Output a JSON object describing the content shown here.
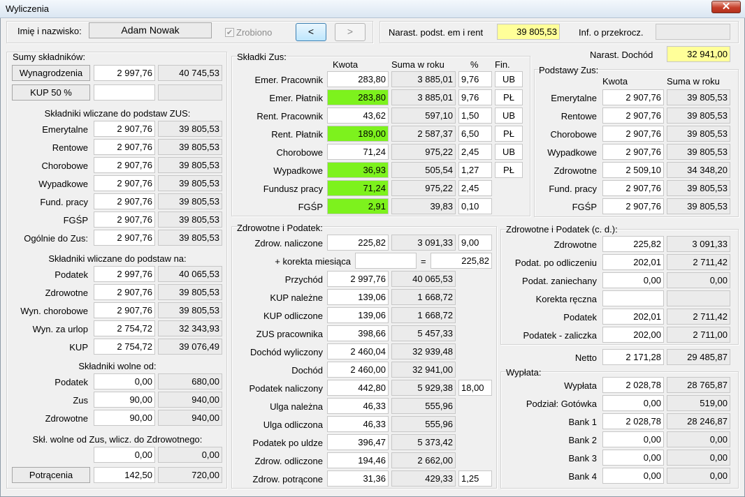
{
  "window": {
    "title": "Wyliczenia",
    "close_glyph": "✕"
  },
  "top": {
    "name_label": "Imię i nazwisko:",
    "name_value": "Adam Nowak",
    "done_label": "Zrobiono",
    "done_checked": true,
    "prev_label": "<",
    "next_label": ">",
    "narast_label": "Narast. podst. em i rent",
    "narast_value": "39 805,53",
    "info_label": "Inf. o przekrocz.",
    "info_value": ""
  },
  "left": {
    "title": "Sumy składników:",
    "wyn": {
      "label": "Wynagrodzenia",
      "kwota": "2 997,76",
      "rok": "40 745,53"
    },
    "kup50": {
      "label": "KUP 50 %",
      "kwota": "",
      "rok": ""
    },
    "zus_header": "Składniki wliczane do podstaw ZUS:",
    "zus_rows": [
      {
        "label": "Emerytalne",
        "kwota": "2 907,76",
        "rok": "39 805,53"
      },
      {
        "label": "Rentowe",
        "kwota": "2 907,76",
        "rok": "39 805,53"
      },
      {
        "label": "Chorobowe",
        "kwota": "2 907,76",
        "rok": "39 805,53"
      },
      {
        "label": "Wypadkowe",
        "kwota": "2 907,76",
        "rok": "39 805,53"
      },
      {
        "label": "Fund. pracy",
        "kwota": "2 907,76",
        "rok": "39 805,53"
      },
      {
        "label": "FGŚP",
        "kwota": "2 907,76",
        "rok": "39 805,53"
      },
      {
        "label": "Ogólnie do Zus:",
        "kwota": "2 907,76",
        "rok": "39 805,53"
      }
    ],
    "na_header": "Składniki wliczane do podstaw na:",
    "na_rows": [
      {
        "label": "Podatek",
        "kwota": "2 997,76",
        "rok": "40 065,53"
      },
      {
        "label": "Zdrowotne",
        "kwota": "2 907,76",
        "rok": "39 805,53"
      },
      {
        "label": "Wyn. chorobowe",
        "kwota": "2 907,76",
        "rok": "39 805,53"
      },
      {
        "label": "Wyn. za urlop",
        "kwota": "2 754,72",
        "rok": "32 343,93"
      },
      {
        "label": "KUP",
        "kwota": "2 754,72",
        "rok": "39 076,49"
      }
    ],
    "wolne_header": "Składniki wolne od:",
    "wolne_rows": [
      {
        "label": "Podatek",
        "kwota": "0,00",
        "rok": "680,00"
      },
      {
        "label": "Zus",
        "kwota": "90,00",
        "rok": "940,00"
      },
      {
        "label": "Zdrowotne",
        "kwota": "90,00",
        "rok": "940,00"
      }
    ],
    "skl_header": "Skł. wolne od Zus, wlicz. do Zdrowotnego:",
    "skl_row": {
      "kwota": "0,00",
      "rok": "0,00"
    },
    "potr": {
      "label": "Potrącenia",
      "kwota": "142,50",
      "rok": "720,00"
    }
  },
  "zus": {
    "title": "Składki Zus:",
    "headers": {
      "kwota": "Kwota",
      "rok": "Suma w roku",
      "pct": "%",
      "fin": "Fin."
    },
    "rows": [
      {
        "label": "Emer. Pracownik",
        "kwota": "283,80",
        "rok": "3 885,01",
        "pct": "9,76",
        "fin": "UB",
        "hl": false
      },
      {
        "label": "Emer. Płatnik",
        "kwota": "283,80",
        "rok": "3 885,01",
        "pct": "9,76",
        "fin": "PŁ",
        "hl": true
      },
      {
        "label": "Rent. Pracownik",
        "kwota": "43,62",
        "rok": "597,10",
        "pct": "1,50",
        "fin": "UB",
        "hl": false
      },
      {
        "label": "Rent. Płatnik",
        "kwota": "189,00",
        "rok": "2 587,37",
        "pct": "6,50",
        "fin": "PŁ",
        "hl": true
      },
      {
        "label": "Chorobowe",
        "kwota": "71,24",
        "rok": "975,22",
        "pct": "2,45",
        "fin": "UB",
        "hl": false
      },
      {
        "label": "Wypadkowe",
        "kwota": "36,93",
        "rok": "505,54",
        "pct": "1,27",
        "fin": "PŁ",
        "hl": true
      },
      {
        "label": "Fundusz pracy",
        "kwota": "71,24",
        "rok": "975,22",
        "pct": "2,45",
        "fin": null,
        "hl": true
      },
      {
        "label": "FGŚP",
        "kwota": "2,91",
        "rok": "39,83",
        "pct": "0,10",
        "fin": null,
        "hl": true
      }
    ]
  },
  "right_top": {
    "dochod_label": "Narast. Dochód",
    "dochod_value": "32 941,00",
    "title": "Podstawy Zus:",
    "headers": {
      "kwota": "Kwota",
      "rok": "Suma w roku"
    },
    "rows": [
      {
        "label": "Emerytalne",
        "kwota": "2 907,76",
        "rok": "39 805,53"
      },
      {
        "label": "Rentowe",
        "kwota": "2 907,76",
        "rok": "39 805,53"
      },
      {
        "label": "Chorobowe",
        "kwota": "2 907,76",
        "rok": "39 805,53"
      },
      {
        "label": "Wypadkowe",
        "kwota": "2 907,76",
        "rok": "39 805,53"
      },
      {
        "label": "Zdrowotne",
        "kwota": "2 509,10",
        "rok": "34 348,20"
      },
      {
        "label": "Fund. pracy",
        "kwota": "2 907,76",
        "rok": "39 805,53"
      },
      {
        "label": "FGŚP",
        "kwota": "2 907,76",
        "rok": "39 805,53"
      }
    ]
  },
  "zdrow": {
    "title": "Zdrowotne i Podatek:",
    "naliczone": {
      "label": "Zdrow. naliczone",
      "kwota": "225,82",
      "rok": "3 091,33",
      "pct": "9,00"
    },
    "korekta": {
      "label": "+ korekta miesiąca",
      "value": "",
      "eq": "=",
      "result": "225,82"
    },
    "rows": [
      {
        "label": "Przychód",
        "kwota": "2 997,76",
        "rok": "40 065,53",
        "extra": null
      },
      {
        "label": "KUP należne",
        "kwota": "139,06",
        "rok": "1 668,72",
        "extra": null
      },
      {
        "label": "KUP odliczone",
        "kwota": "139,06",
        "rok": "1 668,72",
        "extra": null
      },
      {
        "label": "ZUS pracownika",
        "kwota": "398,66",
        "rok": "5 457,33",
        "extra": null
      },
      {
        "label": "Dochód wyliczony",
        "kwota": "2 460,04",
        "rok": "32 939,48",
        "extra": null
      },
      {
        "label": "Dochód",
        "kwota": "2 460,00",
        "rok": "32 941,00",
        "extra": null
      },
      {
        "label": "Podatek naliczony",
        "kwota": "442,80",
        "rok": "5 929,38",
        "extra": "18,00"
      },
      {
        "label": "Ulga należna",
        "kwota": "46,33",
        "rok": "555,96",
        "extra": null
      },
      {
        "label": "Ulga odliczona",
        "kwota": "46,33",
        "rok": "555,96",
        "extra": null
      },
      {
        "label": "Podatek po uldze",
        "kwota": "396,47",
        "rok": "5 373,42",
        "extra": null
      },
      {
        "label": "Zdrow. odliczone",
        "kwota": "194,46",
        "rok": "2 662,00",
        "extra": null
      },
      {
        "label": "Zdrow. potrącone",
        "kwota": "31,36",
        "rok": "429,33",
        "extra": "1,25"
      }
    ]
  },
  "zdrow_cd": {
    "title": "Zdrowotne i Podatek (c. d.):",
    "rows": [
      {
        "label": "Zdrowotne",
        "kwota": "225,82",
        "rok": "3 091,33"
      },
      {
        "label": "Podat. po odliczeniu",
        "kwota": "202,01",
        "rok": "2 711,42"
      },
      {
        "label": "Podat. zaniechany",
        "kwota": "0,00",
        "rok": "0,00"
      },
      {
        "label": "Korekta ręczna",
        "kwota": "",
        "rok": ""
      },
      {
        "label": "Podatek",
        "kwota": "202,01",
        "rok": "2 711,42"
      },
      {
        "label": "Podatek - zaliczka",
        "kwota": "202,00",
        "rok": "2 711,00"
      }
    ],
    "netto": {
      "label": "Netto",
      "kwota": "2 171,28",
      "rok": "29 485,87"
    }
  },
  "wyplata": {
    "title": "Wypłata:",
    "rows": [
      {
        "label": "Wypłata",
        "kwota": "2 028,78",
        "rok": "28 765,87"
      },
      {
        "label": "Podział: Gotówka",
        "kwota": "0,00",
        "rok": "519,00"
      },
      {
        "label": "Bank 1",
        "kwota": "2 028,78",
        "rok": "28 246,87"
      },
      {
        "label": "Bank 2",
        "kwota": "0,00",
        "rok": "0,00"
      },
      {
        "label": "Bank 3",
        "kwota": "0,00",
        "rok": "0,00"
      },
      {
        "label": "Bank 4",
        "kwota": "0,00",
        "rok": "0,00"
      }
    ]
  }
}
